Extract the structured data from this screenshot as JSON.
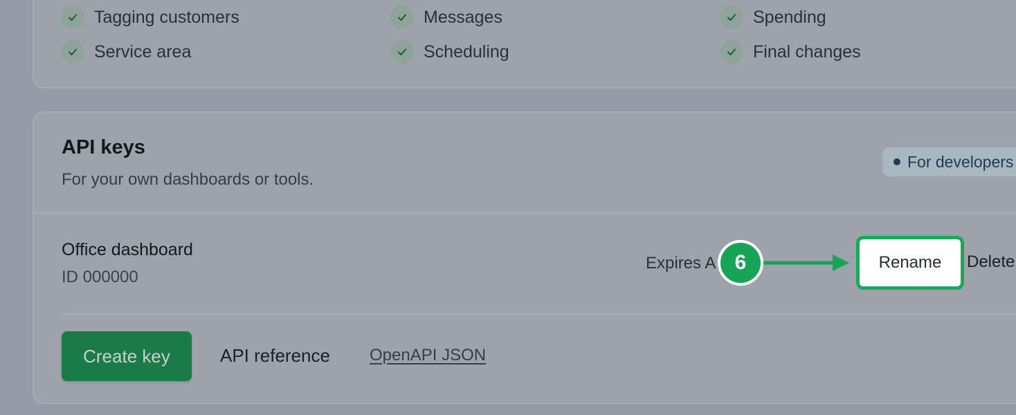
{
  "permissions": [
    {
      "label": "Tagging customers",
      "icon": "check-icon"
    },
    {
      "label": "Messages",
      "icon": "check-icon"
    },
    {
      "label": "Spending",
      "icon": "check-icon"
    },
    {
      "label": "Service area",
      "icon": "check-icon"
    },
    {
      "label": "Scheduling",
      "icon": "check-icon"
    },
    {
      "label": "Final changes",
      "icon": "check-icon"
    }
  ],
  "api_keys": {
    "title": "API keys",
    "subtitle": "For your own dashboards or tools.",
    "badge": "For developers",
    "key": {
      "name": "Office dashboard",
      "id": "ID 000000",
      "expires": "Expires A",
      "rename_label": "Rename",
      "delete_label": "Delete"
    },
    "create_label": "Create key",
    "reference_label": "API reference",
    "openapi_label": "OpenAPI JSON"
  },
  "annotation": {
    "step": "6"
  },
  "colors": {
    "accent_green": "#17a457",
    "button_green": "#1a7a48",
    "badge_text": "#1f3d52"
  }
}
